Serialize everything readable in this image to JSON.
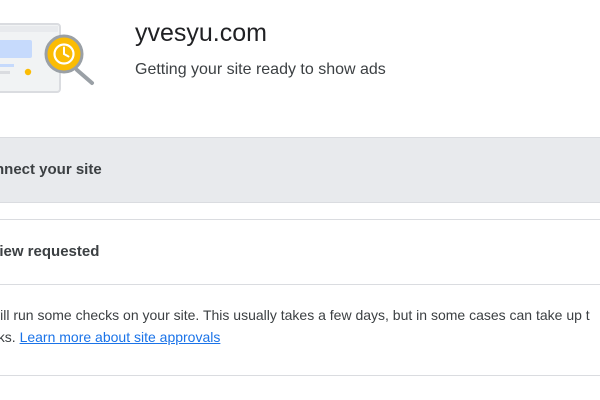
{
  "header": {
    "site_name": "yvesyu.com",
    "status_text": "Getting your site ready to show ads"
  },
  "steps": [
    {
      "label": "nnect your site",
      "state": "active"
    },
    {
      "label": "view requested",
      "state": "expanded"
    }
  ],
  "review": {
    "line1": " will run some checks on your site. This usually takes a few days, but in some cases can take up t",
    "line2_prefix": "eks. ",
    "link_text": "Learn more about site approvals"
  },
  "colors": {
    "accent": "#fbbc04",
    "link": "#1a73e8",
    "active_row": "#e8eaed"
  },
  "icons": {
    "illustration": "site-review-magnifier-clock-icon"
  }
}
